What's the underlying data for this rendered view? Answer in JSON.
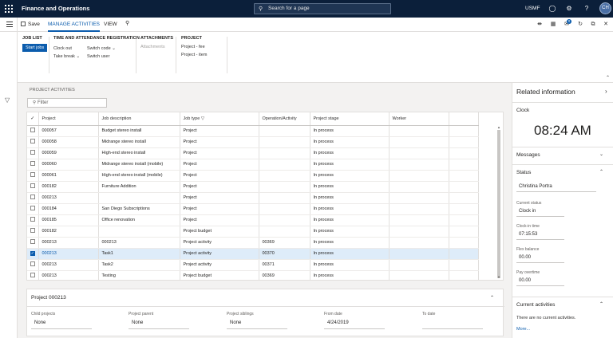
{
  "app": {
    "title": "Finance and Operations",
    "search_placeholder": "Search for a page",
    "company": "USMF",
    "avatar_initials": "CH",
    "icons": [
      "bell-icon",
      "gear-icon",
      "help-icon"
    ]
  },
  "commandbar": {
    "save_label": "Save",
    "tabs": [
      "MANAGE ACTIVITIES",
      "VIEW"
    ],
    "notification_count": "0"
  },
  "ribbon": {
    "groups": [
      {
        "title": "JOB LIST",
        "items": [
          {
            "label": "Start jobs",
            "primary": true
          }
        ]
      },
      {
        "title": "TIME AND ATTENDANCE REGISTRATION",
        "items": [
          {
            "label": "Clock out"
          },
          {
            "label": "Take break"
          },
          {
            "label": "Switch code"
          },
          {
            "label": "Switch user"
          }
        ]
      },
      {
        "title": "ATTACHMENTS",
        "items": [
          {
            "label": "Attachments",
            "disabled": true
          }
        ]
      },
      {
        "title": "PROJECT",
        "items": [
          {
            "label": "Project - fee"
          },
          {
            "label": "Project - item"
          }
        ]
      }
    ]
  },
  "main": {
    "section_label": "PROJECT ACTIVITIES",
    "filter_placeholder": "Filter"
  },
  "grid": {
    "columns": [
      "Project",
      "Job description",
      "Job type",
      "Operation/Activity",
      "Project stage",
      "Worker"
    ],
    "rows": [
      [
        "000057",
        "Budget stereo install",
        "Project",
        "",
        "In process",
        ""
      ],
      [
        "000058",
        "Midrange stereo install",
        "Project",
        "",
        "In process",
        ""
      ],
      [
        "000059",
        "High-end stereo install",
        "Project",
        "",
        "In process",
        ""
      ],
      [
        "000060",
        "Midrange stereo install (mobile)",
        "Project",
        "",
        "In process",
        ""
      ],
      [
        "000061",
        "High-end stereo install (mobile)",
        "Project",
        "",
        "In process",
        ""
      ],
      [
        "000182",
        "Furniture Addition",
        "Project",
        "",
        "In process",
        ""
      ],
      [
        "000213",
        "",
        "Project",
        "",
        "In process",
        ""
      ],
      [
        "000184",
        "San Diego Subscriptions",
        "Project",
        "",
        "In process",
        ""
      ],
      [
        "000185",
        "Office renovation",
        "Project",
        "",
        "In process",
        ""
      ],
      [
        "000182",
        "",
        "Project budget",
        "",
        "In process",
        ""
      ],
      [
        "000213",
        "000213",
        "Project activity",
        "00369",
        "In process",
        ""
      ],
      [
        "000213",
        "Task1",
        "Project activity",
        "00370",
        "In process",
        ""
      ],
      [
        "000213",
        "Task2",
        "Project activity",
        "00371",
        "In process",
        ""
      ],
      [
        "000213",
        "Testing",
        "Project budget",
        "00369",
        "In process",
        ""
      ]
    ],
    "selected_row": 11
  },
  "details": {
    "title": "Project 000213",
    "fields": [
      {
        "label": "Child projects",
        "value": "None"
      },
      {
        "label": "Project parent",
        "value": "None"
      },
      {
        "label": "Project siblings",
        "value": "None"
      },
      {
        "label": "From date",
        "value": "4/24/2019"
      },
      {
        "label": "To date",
        "value": ""
      }
    ]
  },
  "related": {
    "title": "Related information",
    "clock": {
      "title": "Clock",
      "time": "08:24 AM"
    },
    "messages": {
      "title": "Messages"
    },
    "status": {
      "title": "Status",
      "worker": "Christina Portra",
      "fields": [
        {
          "label": "Current status",
          "value": "Clock in"
        },
        {
          "label": "Clock-in time",
          "value": "07:15:53"
        },
        {
          "label": "Flex balance",
          "value": "00.00"
        },
        {
          "label": "Pay overtime",
          "value": "00.00"
        }
      ]
    },
    "activities": {
      "title": "Current activities",
      "empty_text": "There are no current activities.",
      "more": "More..."
    }
  }
}
